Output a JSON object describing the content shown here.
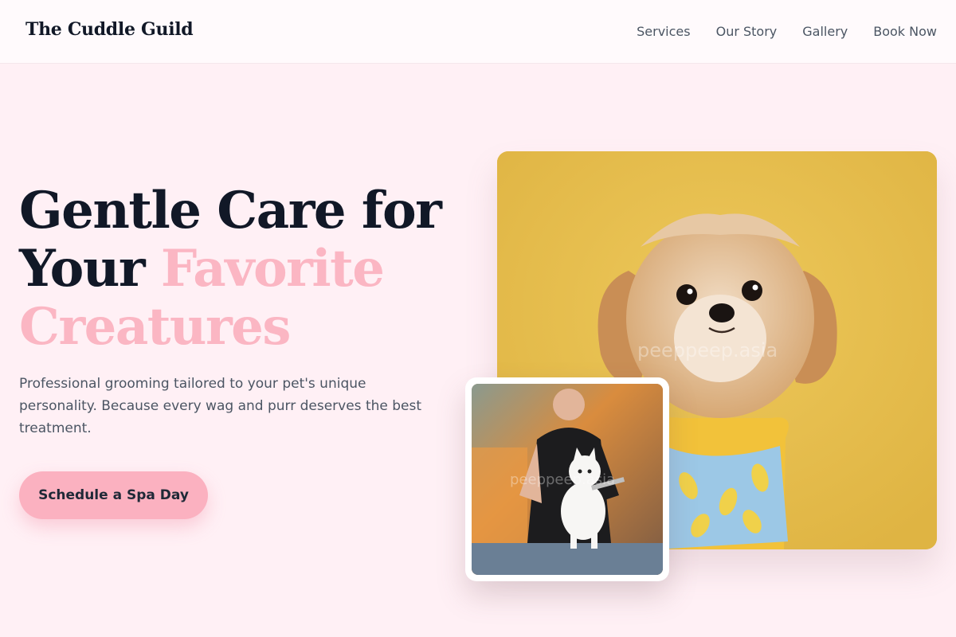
{
  "header": {
    "brand": "The Cuddle Guild",
    "nav": [
      "Services",
      "Our Story",
      "Gallery",
      "Book Now"
    ]
  },
  "hero": {
    "headline_line1": "Gentle Care for",
    "headline_line2_plain": "Your ",
    "headline_line2_accent": "Favorite",
    "headline_line3_accent": "Creatures",
    "lead": "Professional grooming tailored to your pet's unique personality. Because every wag and purr deserves the best treatment.",
    "cta_label": "Schedule a Spa Day"
  },
  "images": {
    "main_watermark": "peeppeep.asia",
    "small_watermark": "peeppeep.asia"
  },
  "colors": {
    "background": "#fff0f5",
    "accent_pink": "#fbb6c3",
    "dark_text": "#111827",
    "photo_yellow": "#e8bf4c"
  }
}
